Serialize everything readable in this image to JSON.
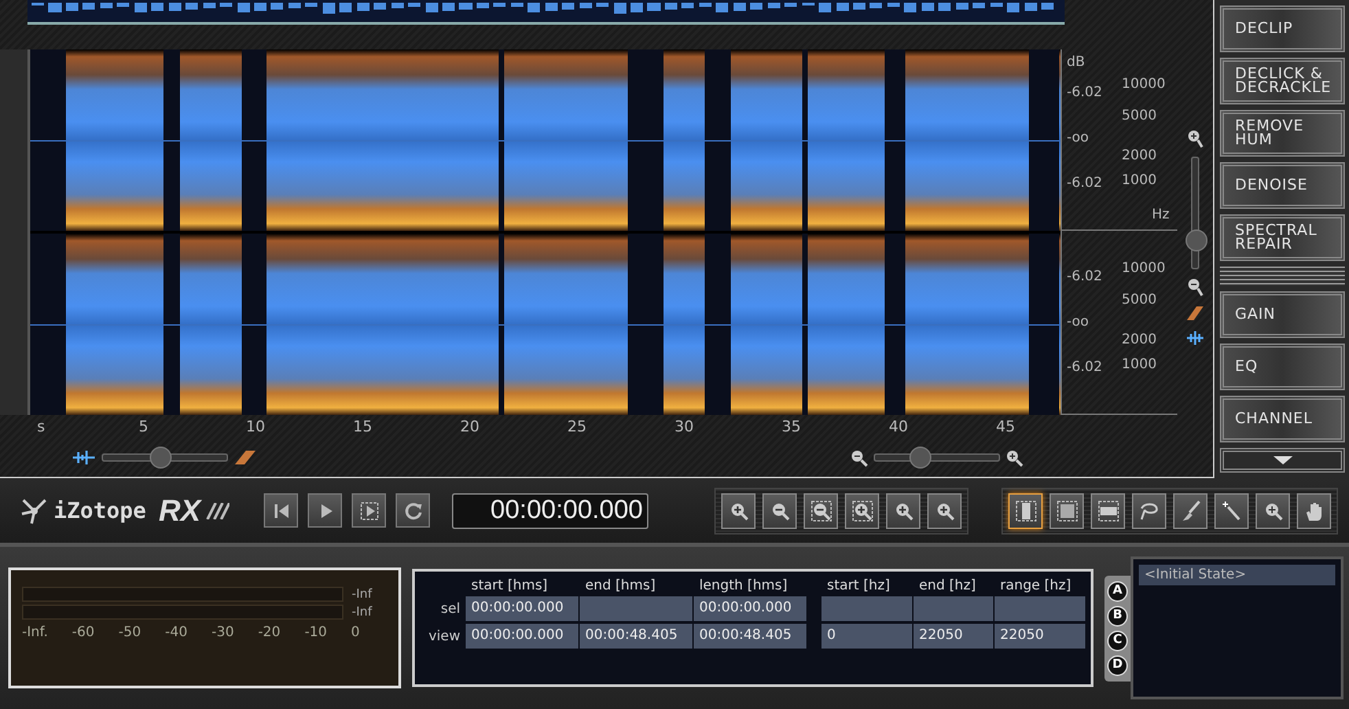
{
  "spectrogram": {
    "channels": [
      {
        "db_unit": "dB",
        "db_labels": [
          "-6.02",
          "-oo",
          "-6.02"
        ],
        "hz_labels": [
          "10000",
          "5000",
          "2000",
          "1000"
        ],
        "hz_unit": "Hz"
      },
      {
        "db_labels": [
          "-6.02",
          "-oo",
          "-6.02"
        ],
        "hz_labels": [
          "10000",
          "5000",
          "2000",
          "1000"
        ]
      }
    ],
    "time_labels": [
      "s",
      "5",
      "10",
      "15",
      "20",
      "25",
      "30",
      "35",
      "40",
      "45"
    ],
    "blend_slider": {
      "level": 0.45
    },
    "zoom_slider": {
      "level": 0.35
    },
    "vertical_zoom": {
      "level": 0.15
    }
  },
  "modules": [
    {
      "kind": "button",
      "label": "DECLIP"
    },
    {
      "kind": "button",
      "label": "DECLICK & DECRACKLE"
    },
    {
      "kind": "button",
      "label": "REMOVE HUM"
    },
    {
      "kind": "button",
      "label": "DENOISE"
    },
    {
      "kind": "button",
      "label": "SPECTRAL REPAIR"
    },
    {
      "kind": "divider"
    },
    {
      "kind": "button",
      "label": "GAIN"
    },
    {
      "kind": "button",
      "label": "EQ"
    },
    {
      "kind": "button",
      "label": "CHANNEL"
    }
  ],
  "logo": {
    "brand": "iZotope",
    "product": "RX"
  },
  "transport": {
    "buttons": [
      {
        "kind": "skip-start"
      },
      {
        "kind": "play"
      },
      {
        "kind": "play-selection"
      },
      {
        "kind": "loop"
      }
    ],
    "time": "00:00:00.000"
  },
  "zoom_tools": [
    {
      "kind": "zoom-in"
    },
    {
      "kind": "zoom-out"
    },
    {
      "kind": "zoom-out-full"
    },
    {
      "kind": "zoom-selection"
    },
    {
      "kind": "zoom-time"
    },
    {
      "kind": "zoom-freq"
    }
  ],
  "tools": [
    {
      "kind": "time-select",
      "selected": true
    },
    {
      "kind": "tf-select",
      "selected": false
    },
    {
      "kind": "freq-select",
      "selected": false
    },
    {
      "kind": "lasso",
      "selected": false
    },
    {
      "kind": "brush",
      "selected": false
    },
    {
      "kind": "wand",
      "selected": false
    },
    {
      "kind": "zoom",
      "selected": false
    },
    {
      "kind": "hand",
      "selected": false
    }
  ],
  "meter": {
    "channels": [
      {
        "reading": "-Inf",
        "level": 0
      },
      {
        "reading": "-Inf",
        "level": 0
      }
    ],
    "scale": [
      "-Inf.",
      "-60",
      "-50",
      "-40",
      "-30",
      "-20",
      "-10",
      "0"
    ]
  },
  "selection_table": {
    "columns": [
      "start [hms]",
      "end [hms]",
      "length [hms]",
      "start [hz]",
      "end [hz]",
      "range [hz]"
    ],
    "rows": [
      {
        "label": "sel",
        "cells": [
          "00:00:00.000",
          "",
          "00:00:00.000",
          "",
          "",
          ""
        ]
      },
      {
        "label": "view",
        "cells": [
          "00:00:00.000",
          "00:00:48.405",
          "00:00:48.405",
          "0",
          "22050",
          "22050"
        ]
      }
    ]
  },
  "snapshots": [
    {
      "label": "A"
    },
    {
      "label": "B"
    },
    {
      "label": "C"
    },
    {
      "label": "D"
    }
  ],
  "history": [
    {
      "label": "<Initial State>",
      "selected": true
    }
  ]
}
